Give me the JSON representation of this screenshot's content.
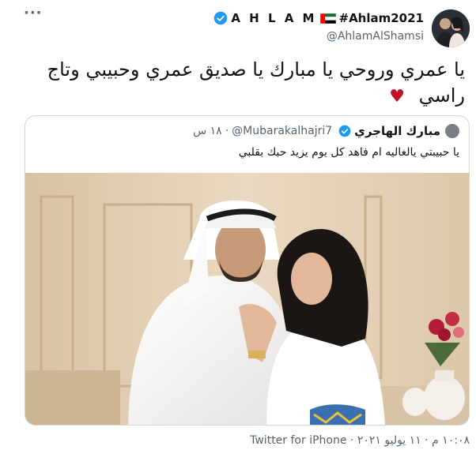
{
  "author": {
    "display_name": "A H L A M",
    "hashtag": "#Ahlam2021",
    "handle": "@AhlamAlShamsi",
    "verified_icon": "verified-badge-icon",
    "flag_icon": "uae-flag-icon"
  },
  "more_icon": "more-options-icon",
  "tweet_text": "يا عمري وروحي يا مبارك يا صديق عمري وحبيبي وتاج راسي",
  "heart": "♥",
  "quote": {
    "display_name": "مبارك الهاجري",
    "handle": "@Mubarakalhajri7",
    "separator": "·",
    "time": "١٨ س",
    "text": "يا حبيبتي يالغاليه ام فاهد كل يوم يزيد حبك بقلبي",
    "verified_icon": "verified-badge-icon"
  },
  "meta": {
    "time": "١٠:٠٨ م",
    "separator1": "·",
    "date": "١١ يوليو ٢٠٢١",
    "separator2": "·",
    "source": "Twitter for iPhone"
  },
  "colors": {
    "accent": "#1d9bf0",
    "heart": "#c0102a",
    "secondary_text": "#536471",
    "border": "#cfd9de"
  }
}
